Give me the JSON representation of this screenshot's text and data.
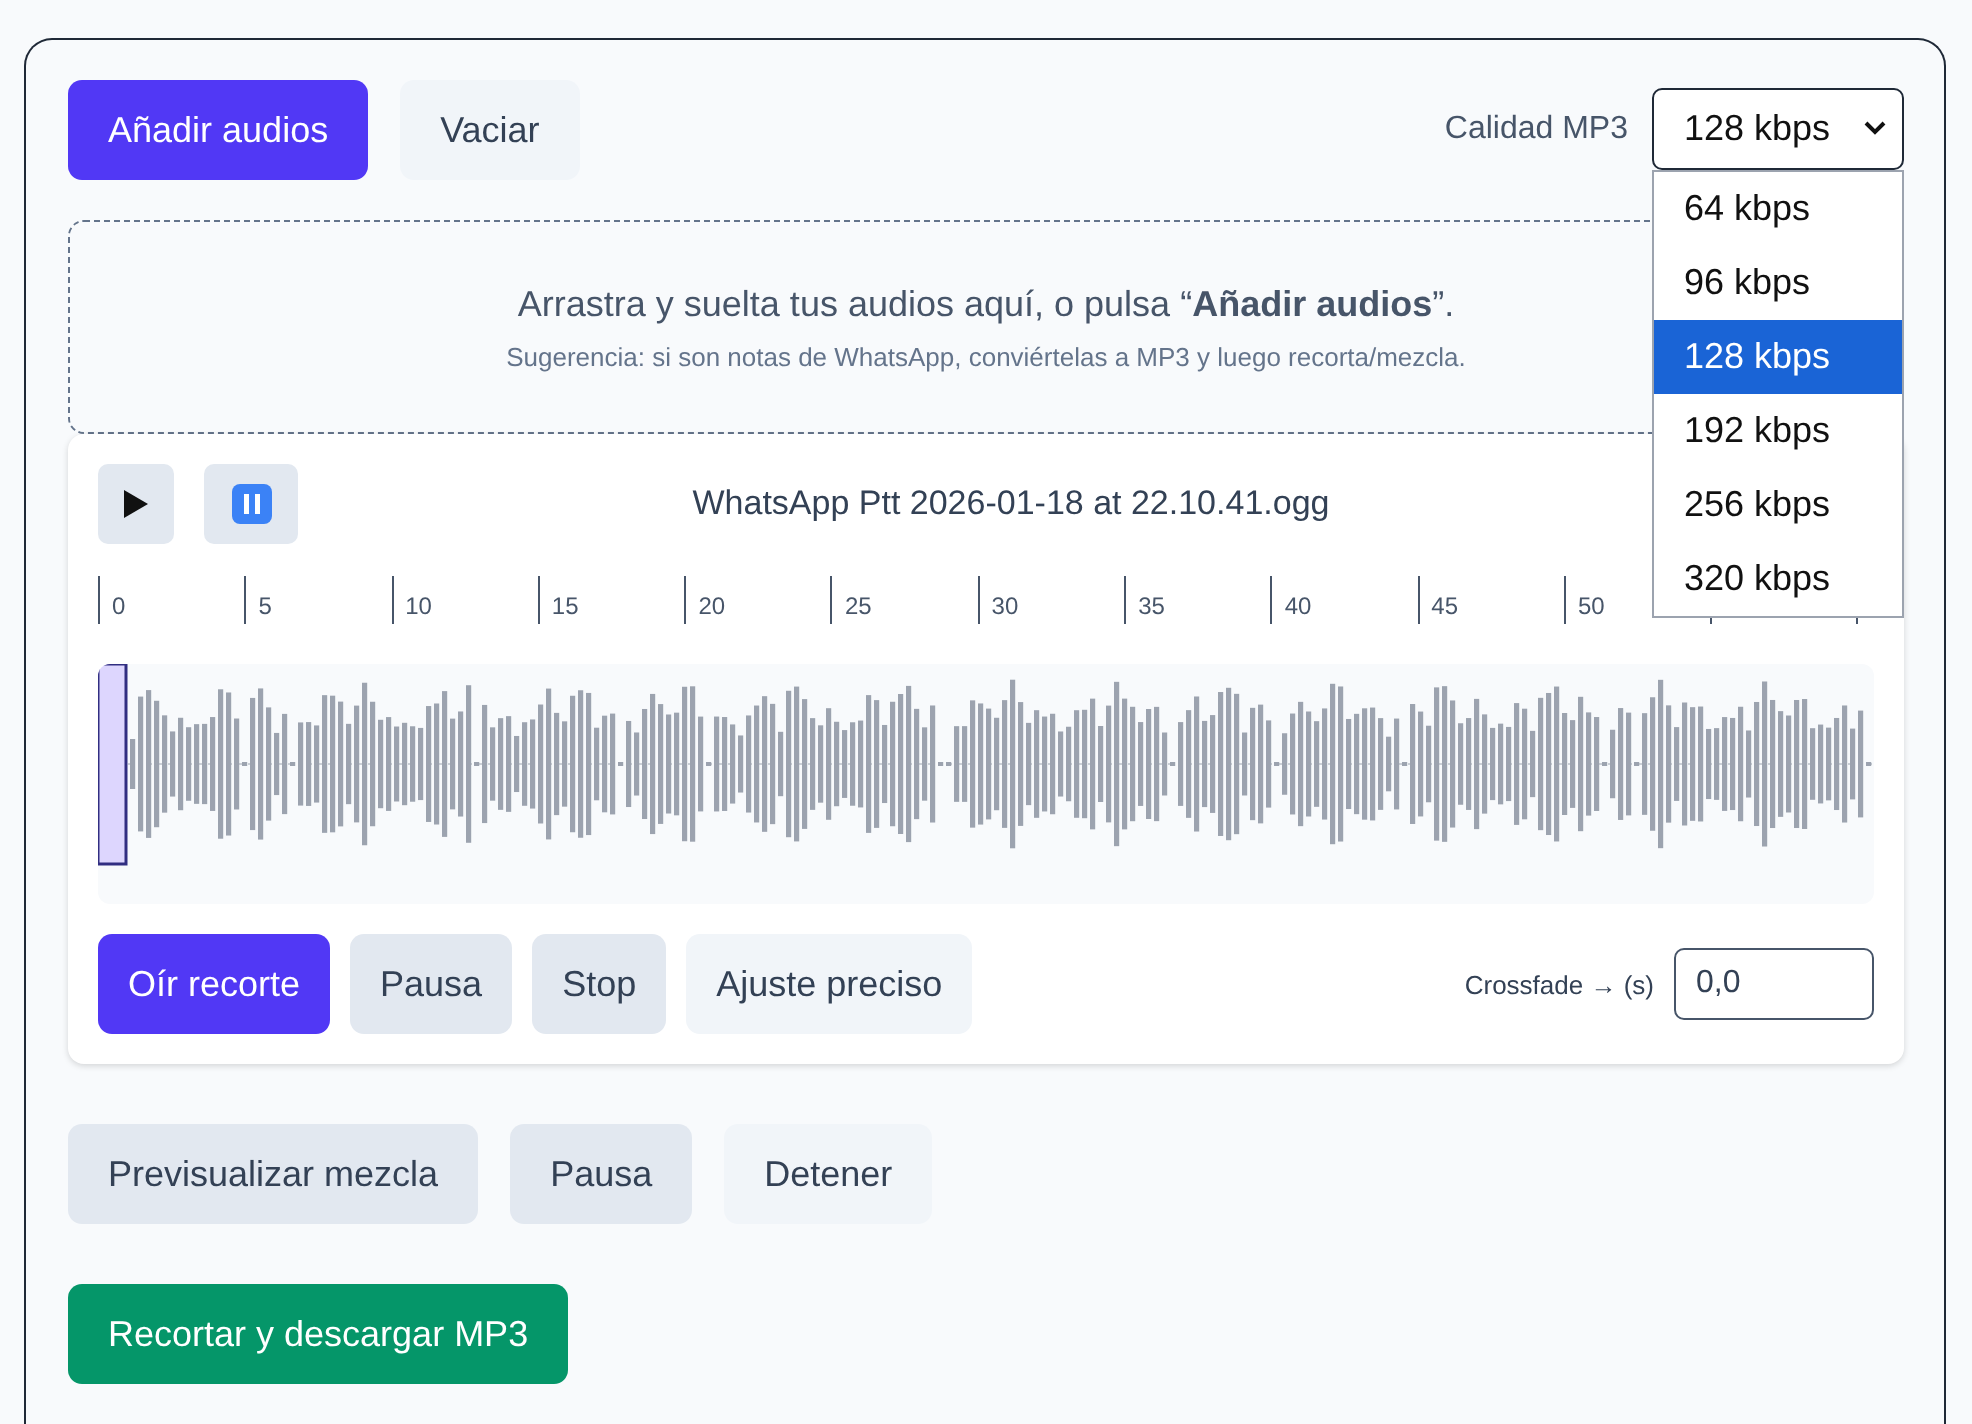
{
  "toolbar": {
    "buttons": [
      {
        "label": "Añadir audios",
        "kind": "primary"
      },
      {
        "label": "Vaciar",
        "kind": "light"
      }
    ],
    "quality": {
      "label": "Calidad MP3",
      "value": "128 kbps",
      "expanded": true,
      "options": [
        {
          "label": "64 kbps",
          "selected": false
        },
        {
          "label": "96 kbps",
          "selected": false
        },
        {
          "label": "128 kbps",
          "selected": true
        },
        {
          "label": "192 kbps",
          "selected": false
        },
        {
          "label": "256 kbps",
          "selected": false
        },
        {
          "label": "320 kbps",
          "selected": false
        }
      ]
    }
  },
  "dropzone": {
    "text": "Arrastra y suelta tus audios aquí, o pulsa “**Añadir audios**”.",
    "hint": "Sugerencia: si son notas de WhatsApp, conviértelas a MP3 y luego recorta/mezcla."
  },
  "clips": [
    {
      "title": "WhatsApp Ptt 2026-01-18 at 22.10.41.ogg",
      "transport": [
        {
          "kind": "play"
        },
        {
          "kind": "pause"
        }
      ],
      "ruler": [
        "0",
        "5",
        "10",
        "15",
        "20",
        "25",
        "30",
        "35",
        "40",
        "45",
        "50"
      ],
      "buttons": [
        {
          "label": "Oír recorte",
          "kind": "primary"
        },
        {
          "label": "Pausa",
          "kind": "secondary"
        },
        {
          "label": "Stop",
          "kind": "secondary"
        },
        {
          "label": "Ajuste preciso",
          "kind": "light"
        }
      ],
      "crossfade": {
        "label": "Crossfade → (s)",
        "value": "0,0"
      }
    }
  ],
  "mix_buttons": [
    {
      "label": "Previsualizar mezcla",
      "kind": "secondary"
    },
    {
      "label": "Pausa",
      "kind": "secondary"
    },
    {
      "label": "Detener",
      "kind": "light"
    }
  ],
  "export_button": {
    "label": "Recortar y descargar MP3",
    "kind": "success"
  }
}
